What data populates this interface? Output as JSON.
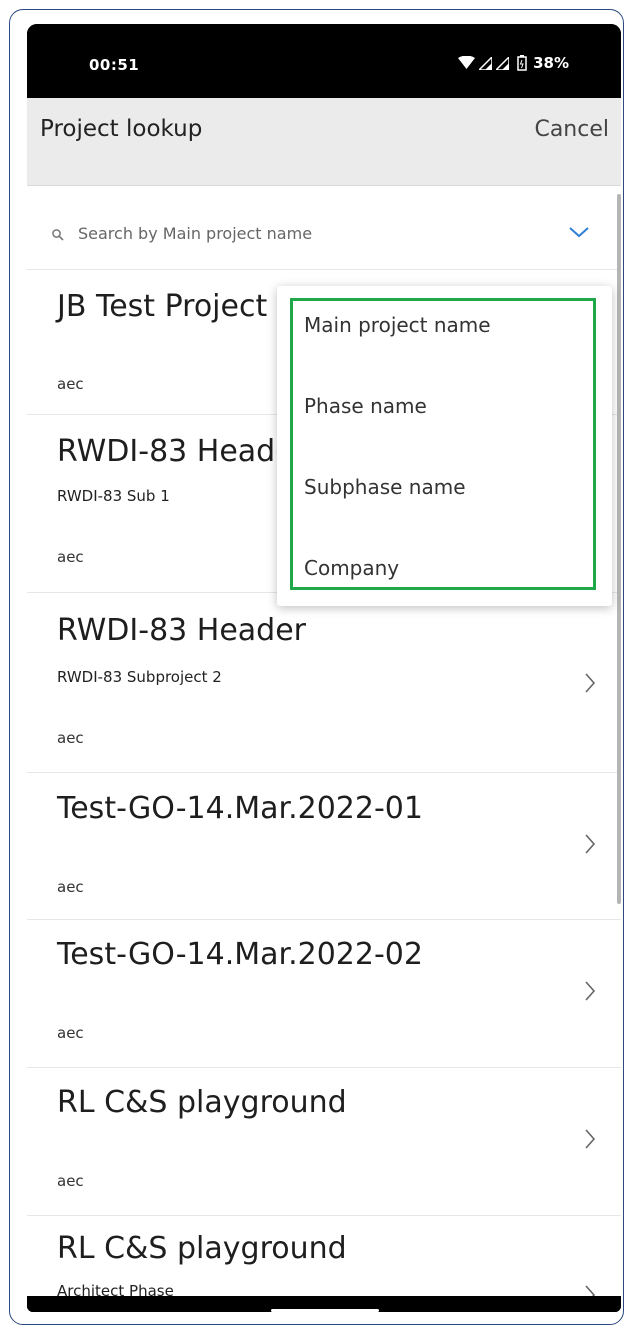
{
  "status_bar": {
    "time": "00:51",
    "battery": "38%",
    "icons": [
      "wifi-icon",
      "signal-icon",
      "signal-icon",
      "battery-icon"
    ]
  },
  "header": {
    "title": "Project lookup",
    "cancel_label": "Cancel"
  },
  "search": {
    "placeholder": "Search by Main project name",
    "icon": "search-icon",
    "toggle_icon": "chevron-down-icon"
  },
  "projects": [
    {
      "title": "JB Test Project",
      "subtitle": "",
      "company": "aec"
    },
    {
      "title": "RWDI-83 Header",
      "subtitle": "RWDI-83 Sub 1",
      "company": "aec"
    },
    {
      "title": "RWDI-83 Header",
      "subtitle": "RWDI-83 Subproject 2",
      "company": "aec"
    },
    {
      "title": "Test-GO-14.Mar.2022-01",
      "subtitle": "",
      "company": "aec"
    },
    {
      "title": "Test-GO-14.Mar.2022-02",
      "subtitle": "",
      "company": "aec"
    },
    {
      "title": "RL C&S playground",
      "subtitle": "",
      "company": "aec"
    },
    {
      "title": "RL C&S playground",
      "subtitle": "Architect Phase",
      "company": ""
    }
  ],
  "search_field_menu": {
    "options": [
      "Main project name",
      "Phase name",
      "Subphase name",
      "Company"
    ]
  },
  "colors": {
    "header_bg": "#ebebeb",
    "highlight": "#1fa84a",
    "accent": "#2f7fd6"
  }
}
